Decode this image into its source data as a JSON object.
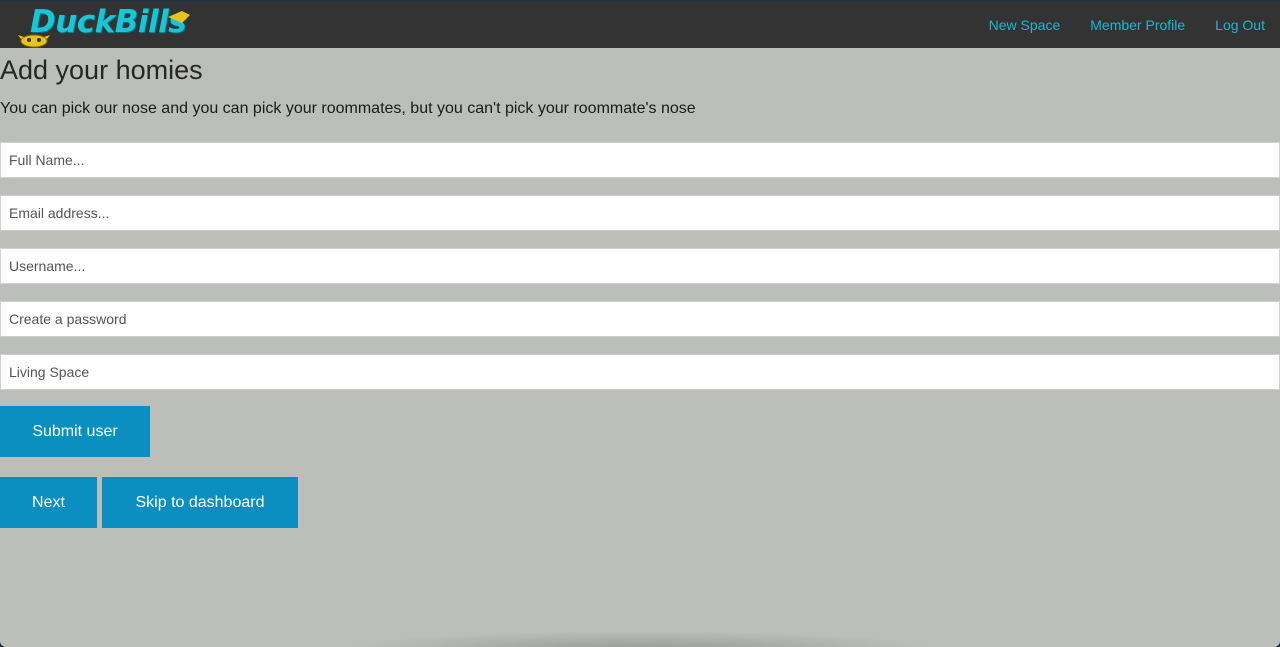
{
  "navbar": {
    "brand": "DuckBills",
    "links": [
      "New Space",
      "Member Profile",
      "Log Out"
    ]
  },
  "main": {
    "title": "Add your homies",
    "subtitle": "You can pick our nose and you can pick your roommates, but you can't pick your roommate's nose",
    "fields": {
      "full_name": "Full Name...",
      "email": "Email address...",
      "username": "Username...",
      "password": "Create a password",
      "living_space": "Living Space"
    },
    "buttons": {
      "submit": "Submit user",
      "next": "Next",
      "skip": "Skip to dashboard"
    }
  },
  "colors": {
    "navbar_bg": "#333333",
    "page_bg": "#bcbeba",
    "link": "#19b9d2",
    "button": "#0a8fc0",
    "brand": "#19c6d8"
  }
}
